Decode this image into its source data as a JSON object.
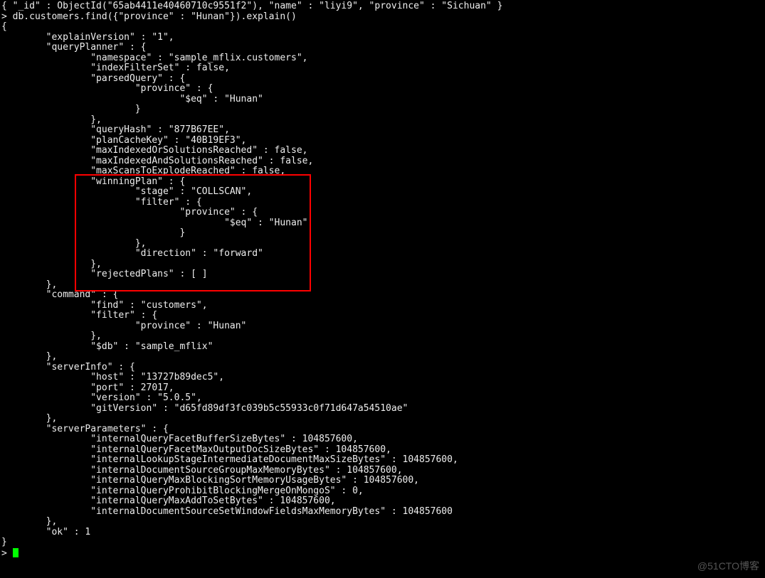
{
  "lines": [
    "{ \"_id\" : ObjectId(\"65ab4411e40460710c9551f2\"), \"name\" : \"liyi9\", \"province\" : \"Sichuan\" }",
    "> db.customers.find({\"province\" : \"Hunan\"}).explain()",
    "{",
    "        \"explainVersion\" : \"1\",",
    "        \"queryPlanner\" : {",
    "                \"namespace\" : \"sample_mflix.customers\",",
    "                \"indexFilterSet\" : false,",
    "                \"parsedQuery\" : {",
    "                        \"province\" : {",
    "                                \"$eq\" : \"Hunan\"",
    "                        }",
    "                },",
    "                \"queryHash\" : \"877B67EE\",",
    "                \"planCacheKey\" : \"40B19EF3\",",
    "                \"maxIndexedOrSolutionsReached\" : false,",
    "                \"maxIndexedAndSolutionsReached\" : false,",
    "                \"maxScansToExplodeReached\" : false,",
    "                \"winningPlan\" : {",
    "                        \"stage\" : \"COLLSCAN\",",
    "                        \"filter\" : {",
    "                                \"province\" : {",
    "                                        \"$eq\" : \"Hunan\"",
    "                                }",
    "                        },",
    "                        \"direction\" : \"forward\"",
    "                },",
    "                \"rejectedPlans\" : [ ]",
    "        },",
    "        \"command\" : {",
    "                \"find\" : \"customers\",",
    "                \"filter\" : {",
    "                        \"province\" : \"Hunan\"",
    "                },",
    "                \"$db\" : \"sample_mflix\"",
    "        },",
    "        \"serverInfo\" : {",
    "                \"host\" : \"13727b89dec5\",",
    "                \"port\" : 27017,",
    "                \"version\" : \"5.0.5\",",
    "                \"gitVersion\" : \"d65fd89df3fc039b5c55933c0f71d647a54510ae\"",
    "        },",
    "        \"serverParameters\" : {",
    "                \"internalQueryFacetBufferSizeBytes\" : 104857600,",
    "                \"internalQueryFacetMaxOutputDocSizeBytes\" : 104857600,",
    "                \"internalLookupStageIntermediateDocumentMaxSizeBytes\" : 104857600,",
    "                \"internalDocumentSourceGroupMaxMemoryBytes\" : 104857600,",
    "                \"internalQueryMaxBlockingSortMemoryUsageBytes\" : 104857600,",
    "                \"internalQueryProhibitBlockingMergeOnMongoS\" : 0,",
    "                \"internalQueryMaxAddToSetBytes\" : 104857600,",
    "                \"internalDocumentSourceSetWindowFieldsMaxMemoryBytes\" : 104857600",
    "        },",
    "        \"ok\" : 1",
    "}",
    "> "
  ],
  "watermark": "@51CTO博客",
  "prompt_char": ">"
}
